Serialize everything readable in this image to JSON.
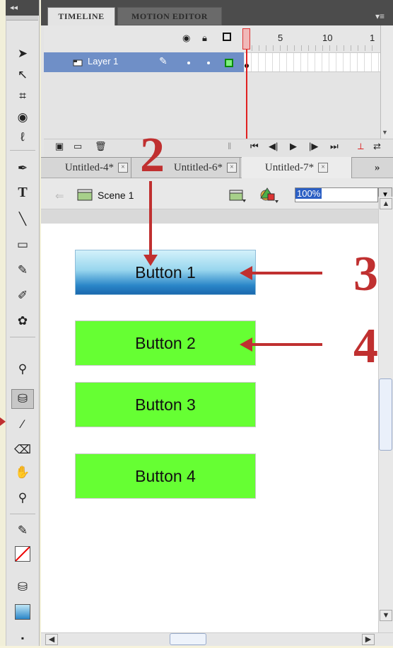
{
  "panel": {
    "collapse_glyph": "◂◂",
    "menu_glyph": "▾≡",
    "tabs": [
      {
        "label": "TIMELINE",
        "active": true
      },
      {
        "label": "MOTION EDITOR",
        "active": false
      }
    ]
  },
  "timeline": {
    "frame_numbers": [
      "1",
      "5",
      "10",
      "1"
    ],
    "header_icons": [
      "eye-icon",
      "lock-icon",
      "outline-icon"
    ],
    "layers": [
      {
        "name": "Layer 1",
        "selected": true
      }
    ]
  },
  "document_tabs": [
    {
      "label": "Untitled-4*",
      "active": false
    },
    {
      "label": "Untitled-6*",
      "active": false
    },
    {
      "label": "Untitled-7*",
      "active": true
    }
  ],
  "doc_tabs_overflow": "»",
  "edit_bar": {
    "scene_label": "Scene 1",
    "zoom_value": "100%"
  },
  "stage_buttons": [
    {
      "label": "Button 1",
      "color": "#2a86c8"
    },
    {
      "label": "Button 2",
      "color": "#66ff33"
    },
    {
      "label": "Button 3",
      "color": "#66ff33"
    },
    {
      "label": "Button 4",
      "color": "#66ff33"
    }
  ],
  "annotations": {
    "callout_2": "2",
    "callout_3": "3",
    "callout_4": "4",
    "color": "#c03030"
  },
  "tools": [
    "selection-tool",
    "subselection-tool",
    "free-transform-tool",
    "3d-rotation-tool",
    "lasso-tool",
    "pen-tool",
    "text-tool",
    "line-tool",
    "rectangle-tool",
    "pencil-tool",
    "brush-tool",
    "deco-tool",
    "bone-tool",
    "paint-bucket-tool",
    "eyedropper-tool",
    "eraser-tool",
    "hand-tool",
    "zoom-tool",
    "stroke-color",
    "fill-color",
    "swap-colors"
  ]
}
